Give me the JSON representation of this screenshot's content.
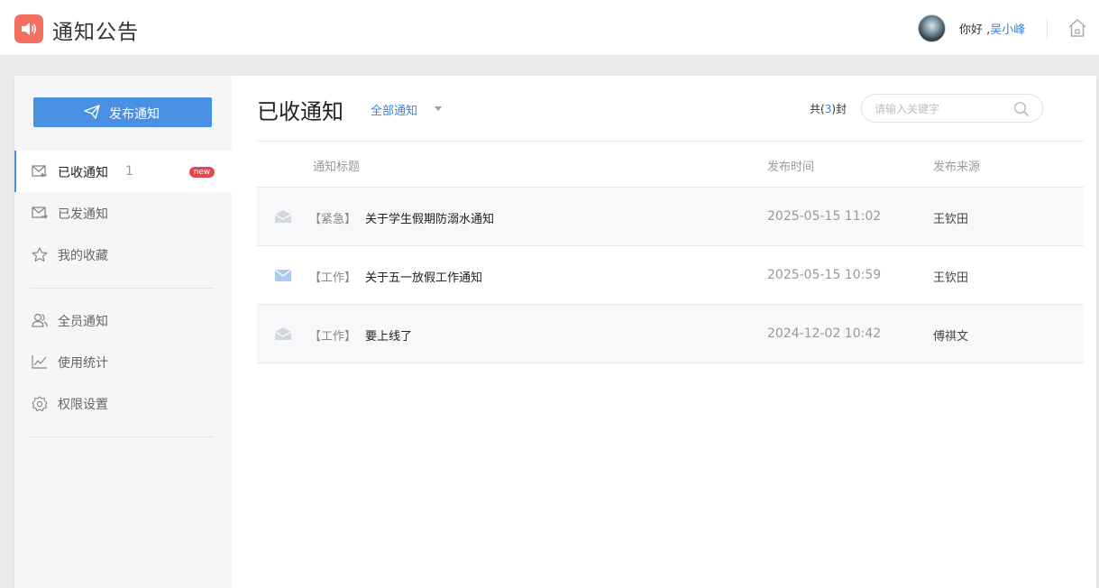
{
  "header": {
    "app_title": "通知公告",
    "greeting_prefix": "你好 ,",
    "username": "吴小峰",
    "icons": {
      "logo": "speaker-icon",
      "home": "home-icon",
      "avatar": "user-avatar"
    },
    "colors": {
      "logo_bg": "#f2705f",
      "accent": "#4a90e2"
    }
  },
  "sidebar": {
    "publish_button": "发布通知",
    "primary_items": [
      {
        "label": "已收通知",
        "icon": "inbox-icon",
        "count": "1",
        "badge": "new",
        "active": true
      },
      {
        "label": "已发通知",
        "icon": "sent-icon"
      },
      {
        "label": "我的收藏",
        "icon": "star-icon"
      }
    ],
    "admin_items": [
      {
        "label": "全员通知",
        "icon": "users-icon"
      },
      {
        "label": "使用统计",
        "icon": "chart-icon"
      },
      {
        "label": "权限设置",
        "icon": "gear-icon"
      }
    ]
  },
  "main": {
    "title": "已收通知",
    "filter_label": "全部通知",
    "total_prefix": "共(",
    "total_count": "3",
    "total_suffix": ")封",
    "search_placeholder": "请输入关键字",
    "table": {
      "columns": [
        "通知标题",
        "发布时间",
        "发布来源"
      ],
      "rows": [
        {
          "tag": "【紧急】",
          "title": "关于学生假期防溺水通知",
          "time": "2025-05-15 11:02",
          "source": "王钦田",
          "status": "read"
        },
        {
          "tag": "【工作】",
          "title": "关于五一放假工作通知",
          "time": "2025-05-15 10:59",
          "source": "王钦田",
          "status": "unread"
        },
        {
          "tag": "【工作】",
          "title": "要上线了",
          "time": "2024-12-02 10:42",
          "source": "傅祺文",
          "status": "read"
        }
      ]
    }
  }
}
